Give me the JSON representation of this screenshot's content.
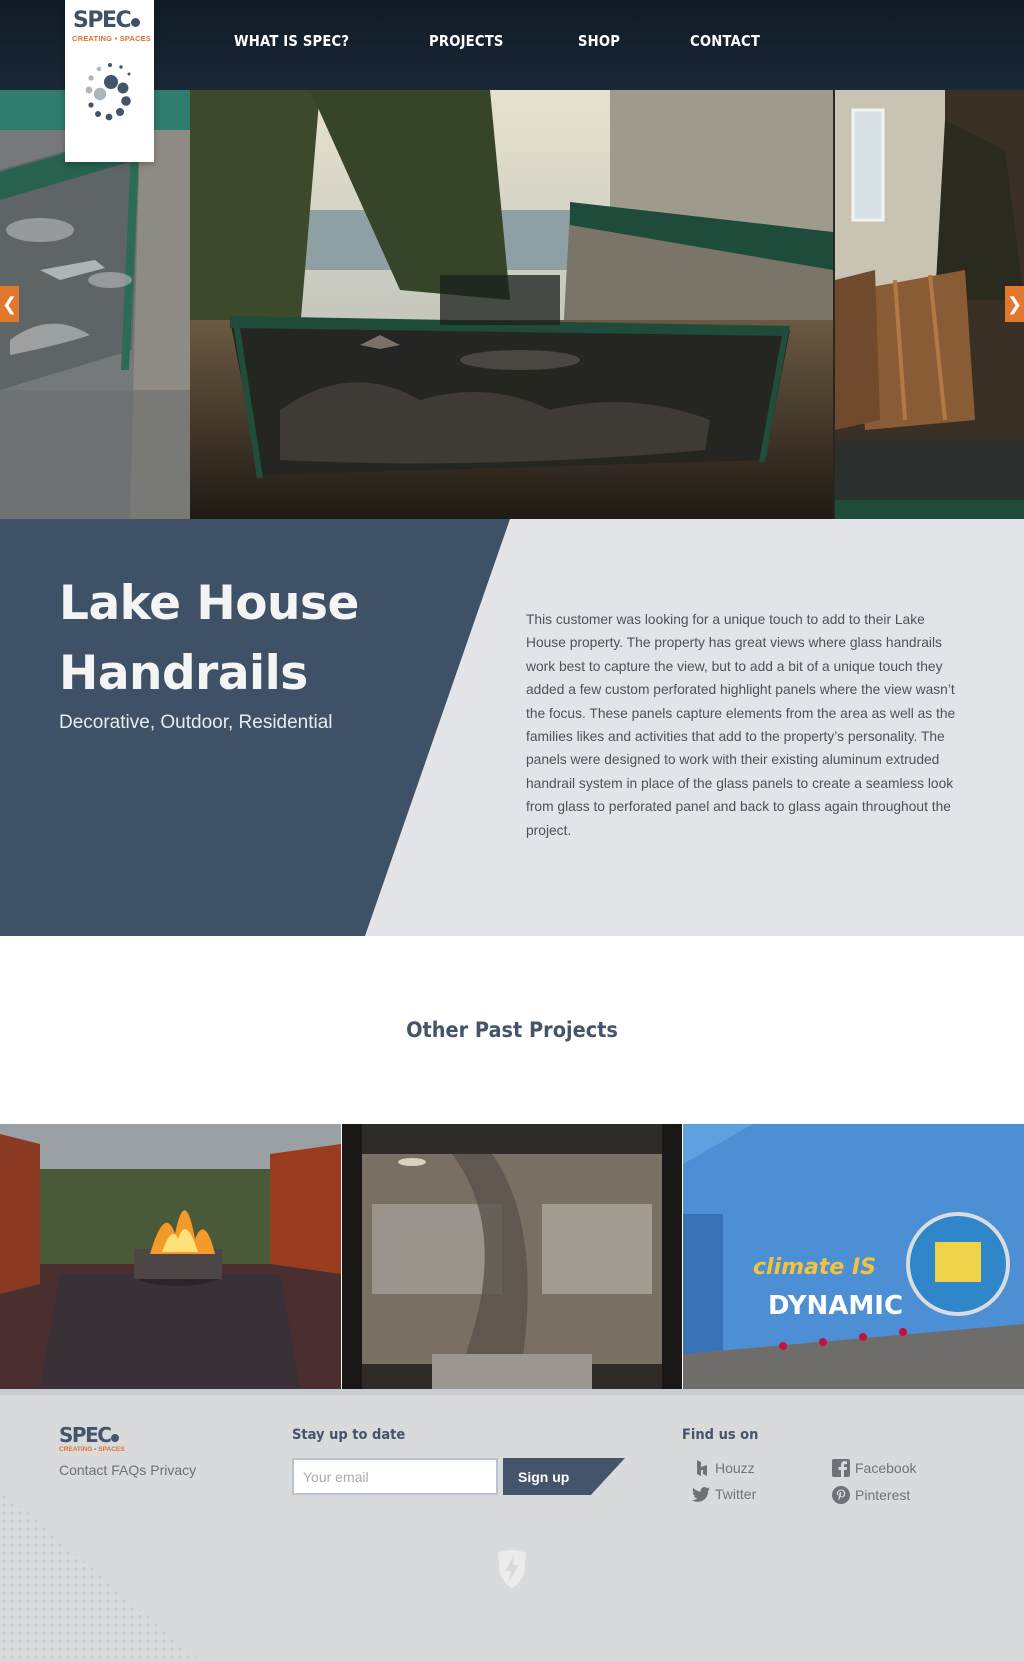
{
  "brand": {
    "name": "SPEC",
    "tagline": "CREATING • SPACES"
  },
  "nav": {
    "items": [
      "WHAT IS SPEC?",
      "PROJECTS",
      "SHOP",
      "CONTACT"
    ]
  },
  "carousel": {
    "prev_icon": "chevron-left-icon",
    "next_icon": "chevron-right-icon",
    "prev_glyph": "❮",
    "next_glyph": "❯"
  },
  "project": {
    "title": "Lake House Handrails",
    "tags": "Decorative, Outdoor, Residential",
    "description": "This customer was looking for a unique touch to add to their Lake House property. The property has great views where glass handrails work best to capture the view, but to add a bit of a unique touch they added a few custom perforated highlight panels where the view wasn’t the focus. These panels capture elements from the area as well as the families likes and activities that add to the property’s personality. The panels were designed to work with their existing aluminum extruded handrail system in place of the glass panels to create a seamless look from glass to perforated panel and back to glass again throughout the project."
  },
  "past_projects": {
    "heading": "Other Past Projects",
    "sign_text_1": "climate IS",
    "sign_text_2": "DYNAMIC"
  },
  "footer": {
    "links": [
      "Contact",
      "FAQs",
      "Privacy"
    ],
    "newsletter_heading": "Stay up to date",
    "email_placeholder": "Your email",
    "signup_label": "Sign up",
    "social_heading": "Find us on",
    "social": [
      {
        "label": "Houzz",
        "icon": "houzz-icon"
      },
      {
        "label": "Facebook",
        "icon": "facebook-icon"
      },
      {
        "label": "Twitter",
        "icon": "twitter-icon"
      },
      {
        "label": "Pinterest",
        "icon": "pinterest-icon"
      }
    ]
  },
  "colors": {
    "header_bg": "#16212d",
    "accent_orange": "#e2772e",
    "slate_blue": "#3f5166",
    "info_bg": "#e3e4e7",
    "footer_bg": "#d9dadb"
  }
}
